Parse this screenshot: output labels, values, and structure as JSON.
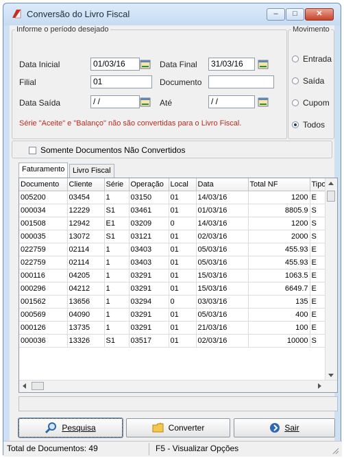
{
  "window": {
    "title": "Conversão do Livro Fiscal",
    "minimize": "–",
    "maximize": "□",
    "close": "✕"
  },
  "periodo": {
    "legend": "Informe o período desejado",
    "data_inicial_label": "Data Inicial",
    "data_inicial_value": "01/03/16",
    "data_final_label": "Data Final",
    "data_final_value": "31/03/16",
    "filial_label": "Filial",
    "filial_value": "01",
    "documento_label": "Documento",
    "documento_value": "",
    "data_saida_label": "Data Saída",
    "data_saida_value": "/ /",
    "ate_label": "Até",
    "ate_value": "/ /",
    "aviso": "Série \"Aceite\" e \"Balanço\" não são convertidas para o Livro Fiscal."
  },
  "movimento": {
    "legend": "Movimento",
    "options": [
      "Entrada",
      "Saída",
      "Cupom",
      "Todos"
    ],
    "selected": "Todos"
  },
  "somente_label": "Somente Documentos Não Convertidos",
  "tabs": [
    "Faturamento",
    "Livro Fiscal"
  ],
  "table": {
    "headers": [
      "Documento",
      "Cliente",
      "Série",
      "Operação",
      "Local",
      "Data",
      "Total NF",
      "Tipo"
    ],
    "rows": [
      [
        "005200",
        "03454",
        "1",
        "03150",
        "01",
        "14/03/16",
        "1200",
        "E"
      ],
      [
        "000034",
        "12229",
        "S1",
        "03461",
        "01",
        "01/03/16",
        "8805.9",
        "S"
      ],
      [
        "001508",
        "12942",
        "E1",
        "03209",
        "0",
        "14/03/16",
        "1200",
        "S"
      ],
      [
        "000035",
        "13072",
        "S1",
        "03121",
        "01",
        "02/03/16",
        "2000",
        "S"
      ],
      [
        "022759",
        "02114",
        "1",
        "03403",
        "01",
        "05/03/16",
        "455.93",
        "E"
      ],
      [
        "022759",
        "02114",
        "1",
        "03403",
        "01",
        "05/03/16",
        "455.93",
        "E"
      ],
      [
        "000116",
        "04205",
        "1",
        "03291",
        "01",
        "15/03/16",
        "1063.5",
        "E"
      ],
      [
        "000296",
        "04212",
        "1",
        "03291",
        "01",
        "15/03/16",
        "6649.7",
        "E"
      ],
      [
        "001562",
        "13656",
        "1",
        "03294",
        "0",
        "03/03/16",
        "135",
        "E"
      ],
      [
        "000569",
        "04090",
        "1",
        "03291",
        "01",
        "05/03/16",
        "400",
        "E"
      ],
      [
        "000126",
        "13735",
        "1",
        "03291",
        "01",
        "21/03/16",
        "100",
        "E"
      ],
      [
        "000036",
        "13326",
        "S1",
        "03517",
        "01",
        "02/03/16",
        "10000",
        "S"
      ]
    ]
  },
  "buttons": {
    "pesquisa": "Pesquisa",
    "converter": "Converter",
    "sair": "Sair"
  },
  "status": {
    "total": "Total de Documentos: 49",
    "hint": "F5 - Visualizar Opções"
  },
  "colors": {
    "accent_red": "#c0281d",
    "title_bar": "#c6dbf2"
  }
}
